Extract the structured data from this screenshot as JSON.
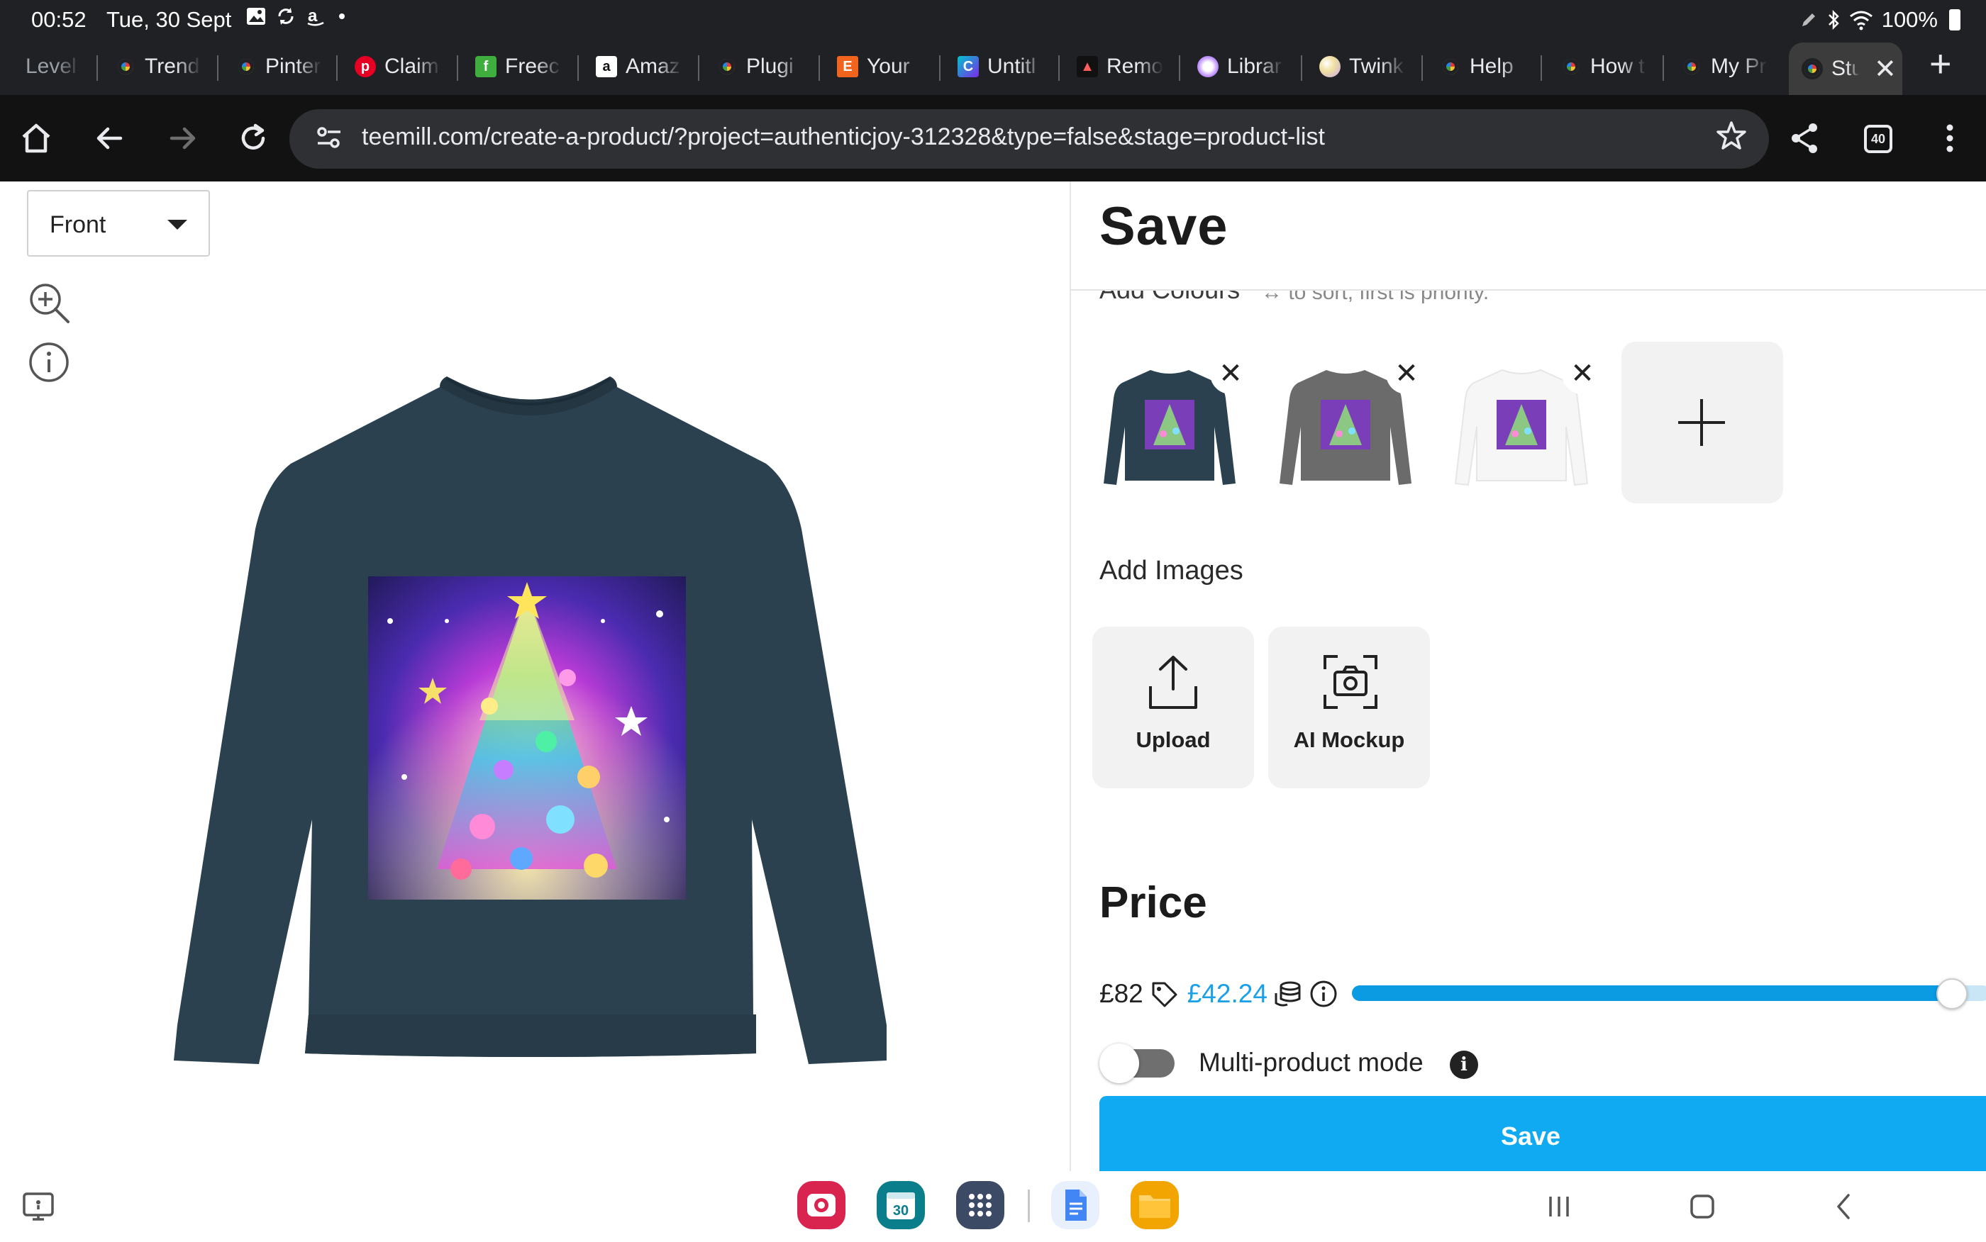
{
  "status_bar": {
    "time": "00:52",
    "date": "Tue, 30 Sept",
    "battery": "100%"
  },
  "browser": {
    "tabs": [
      {
        "title": "Level",
        "favicon": "none-icon"
      },
      {
        "title": "Trend",
        "favicon": "rainbow-icon"
      },
      {
        "title": "Pinter",
        "favicon": "rainbow-icon"
      },
      {
        "title": "Claim",
        "favicon": "pinterest-icon"
      },
      {
        "title": "Freec",
        "favicon": "freecash-icon"
      },
      {
        "title": "Amaz",
        "favicon": "amazon-icon"
      },
      {
        "title": "Plugi",
        "favicon": "rainbow-icon"
      },
      {
        "title": "Your",
        "favicon": "etsy-icon"
      },
      {
        "title": "Untitl",
        "favicon": "canva-icon"
      },
      {
        "title": "Remo",
        "favicon": "remove-bg-icon"
      },
      {
        "title": "Librar",
        "favicon": "library-icon"
      },
      {
        "title": "Twink",
        "favicon": "twinkle-icon"
      },
      {
        "title": "Help",
        "favicon": "rainbow-icon"
      },
      {
        "title": "How t",
        "favicon": "rainbow-icon"
      },
      {
        "title": "My Pr",
        "favicon": "rainbow-icon"
      },
      {
        "title": "Stu",
        "favicon": "rainbow-icon",
        "active": true
      }
    ],
    "url": "teemill.com/create-a-product/?project=authenticjoy-312328&type=false&stage=product-list",
    "tab_count": "40"
  },
  "editor": {
    "view_select": "Front",
    "product": "sweatshirt",
    "product_colour": "#2c4150"
  },
  "panel": {
    "heading": "Save",
    "add_colours_label": "Add Colours",
    "sort_hint": "↔ to sort, first is priority.",
    "colours": [
      {
        "name": "navy",
        "hex": "#2c4150"
      },
      {
        "name": "grey",
        "hex": "#6b6b6b"
      },
      {
        "name": "white",
        "hex": "#f6f6f6"
      }
    ],
    "add_images_label": "Add Images",
    "image_buttons": [
      {
        "label": "Upload",
        "icon": "upload-icon"
      },
      {
        "label": "AI Mockup",
        "icon": "camera-scan-icon"
      }
    ],
    "price_heading": "Price",
    "price": "£82",
    "earnings": "£42.24",
    "price_slider_fraction": 0.94,
    "multi_product_label": "Multi-product mode",
    "multi_product_enabled": false,
    "save_button": "Save"
  },
  "colors": {
    "accent": "#10aaf2",
    "earnings": "#1aa0e6",
    "browser_dark": "#202124"
  }
}
